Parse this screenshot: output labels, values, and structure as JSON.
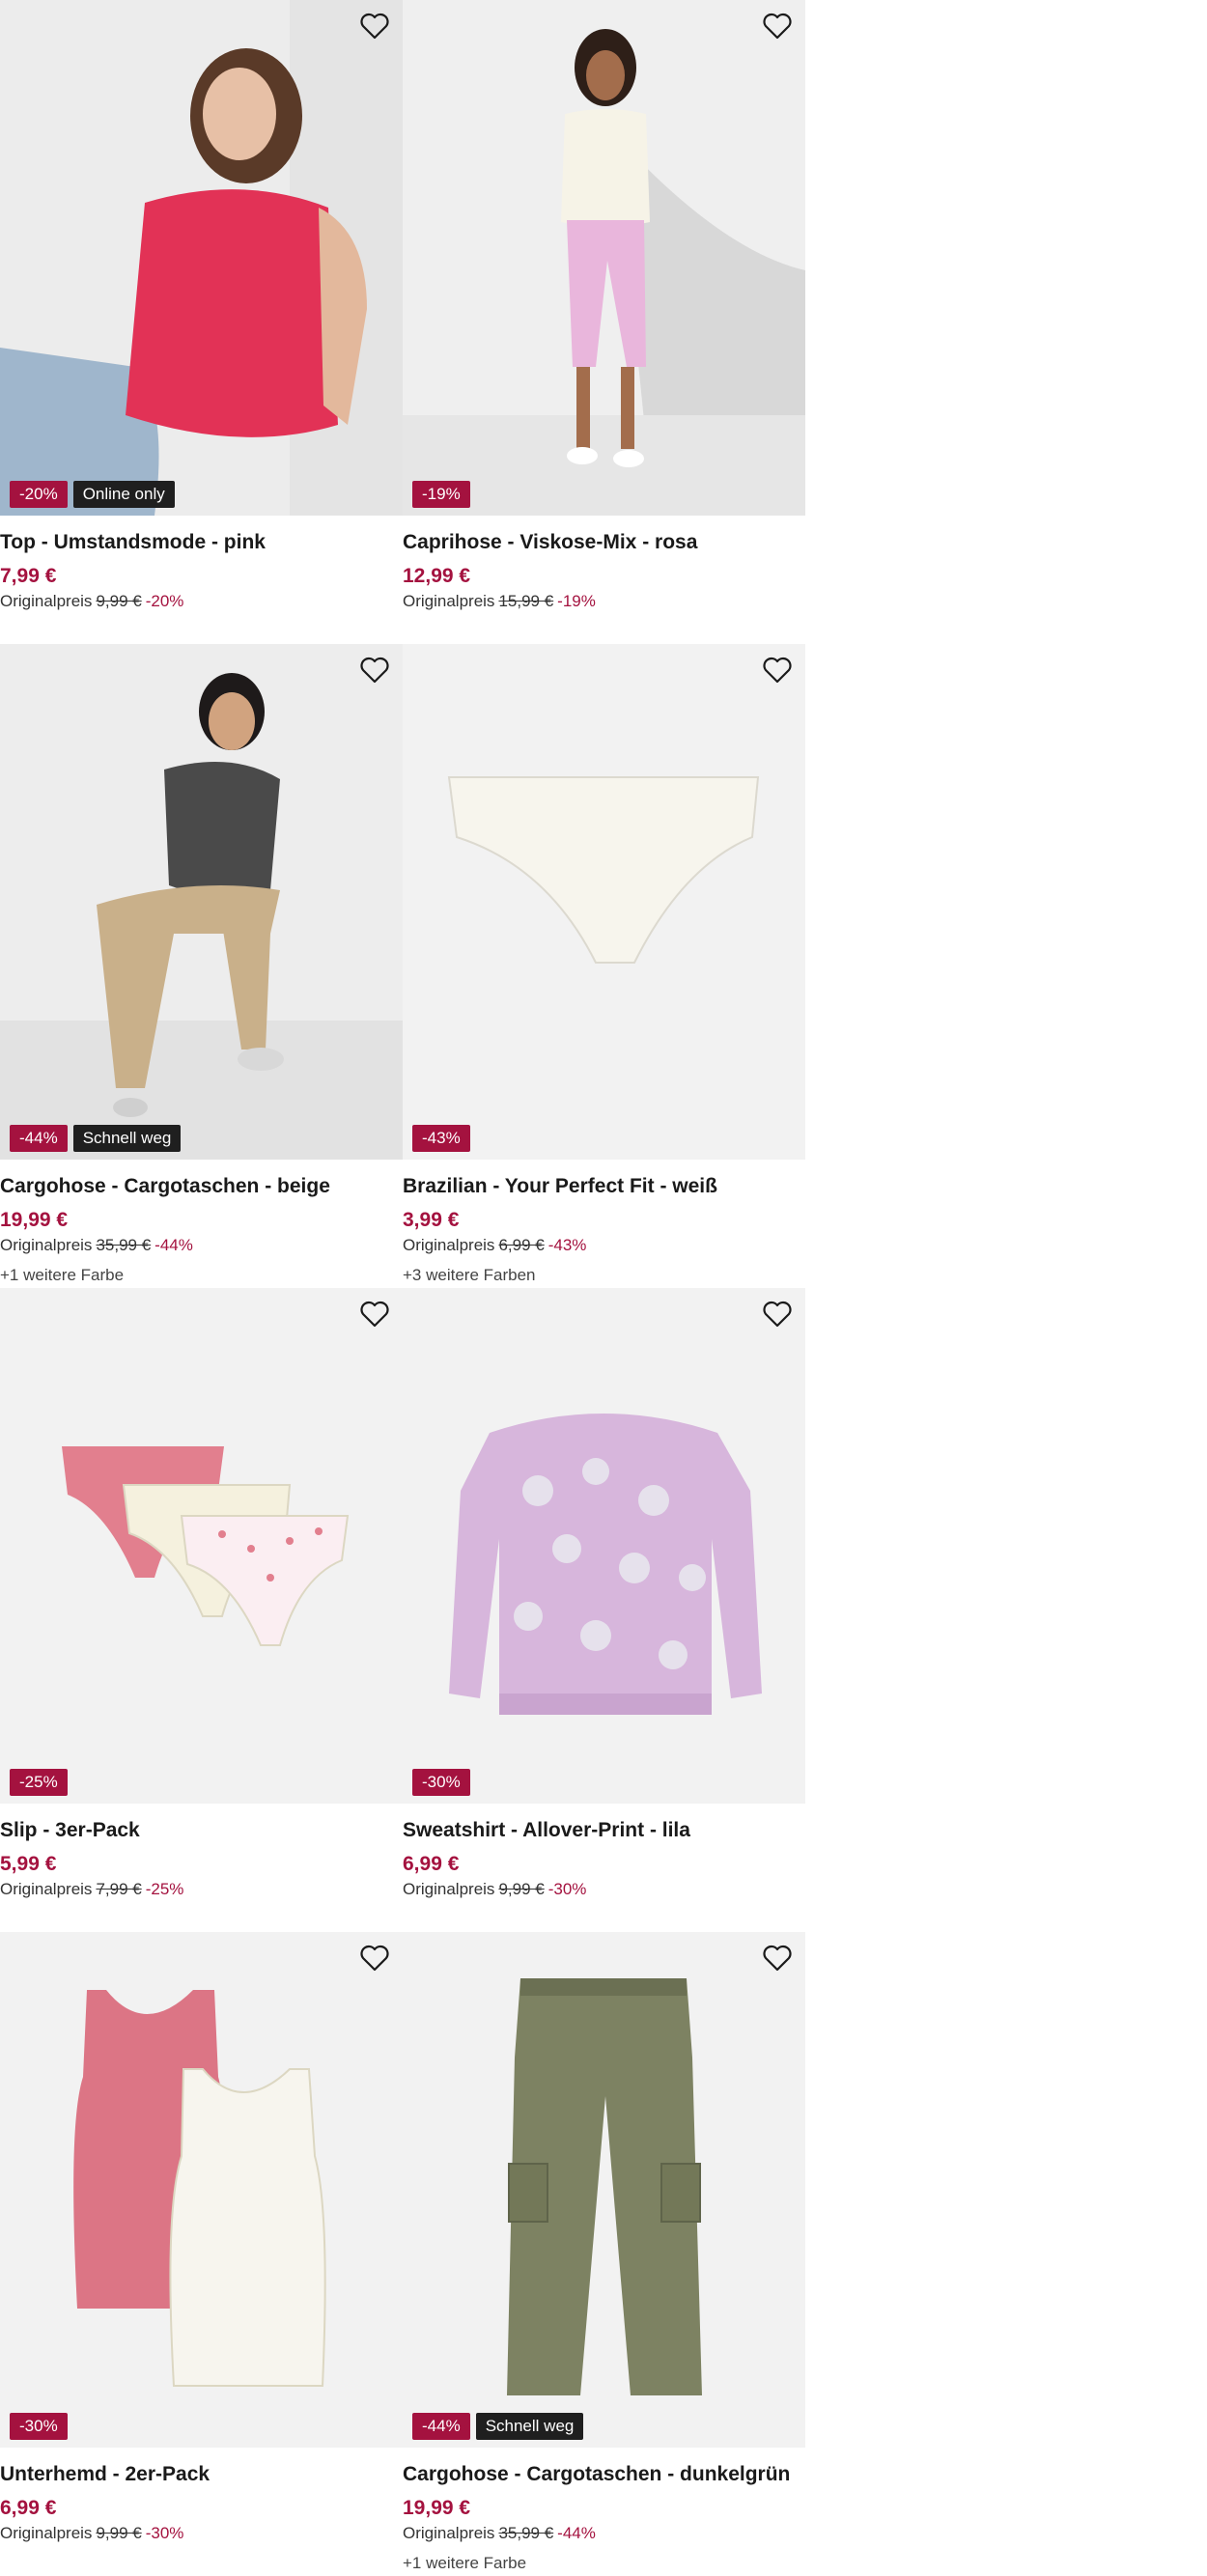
{
  "products": [
    {
      "name": "Top - Umstandsmode - pink",
      "price": "7,99 €",
      "orig_label": "Originalpreis",
      "orig_price": "9,99 €",
      "orig_pct": "-20%",
      "badges": [
        "-20%",
        "Online only"
      ],
      "colors": ""
    },
    {
      "name": "Caprihose - Viskose-Mix - rosa",
      "price": "12,99 €",
      "orig_label": "Originalpreis",
      "orig_price": "15,99 €",
      "orig_pct": "-19%",
      "badges": [
        "-19%"
      ],
      "colors": ""
    },
    {
      "name": "Cargohose - Cargotaschen - beige",
      "price": "19,99 €",
      "orig_label": "Originalpreis",
      "orig_price": "35,99 €",
      "orig_pct": "-44%",
      "badges": [
        "-44%",
        "Schnell weg"
      ],
      "colors": "+1 weitere Farbe"
    },
    {
      "name": "Brazilian - Your Perfect Fit - weiß",
      "price": "3,99 €",
      "orig_label": "Originalpreis",
      "orig_price": "6,99 €",
      "orig_pct": "-43%",
      "badges": [
        "-43%"
      ],
      "colors": "+3 weitere Farben"
    },
    {
      "name": "Slip - 3er-Pack",
      "price": "5,99 €",
      "orig_label": "Originalpreis",
      "orig_price": "7,99 €",
      "orig_pct": "-25%",
      "badges": [
        "-25%"
      ],
      "colors": ""
    },
    {
      "name": "Sweatshirt - Allover-Print - lila",
      "price": "6,99 €",
      "orig_label": "Originalpreis",
      "orig_price": "9,99 €",
      "orig_pct": "-30%",
      "badges": [
        "-30%"
      ],
      "colors": ""
    },
    {
      "name": "Unterhemd - 2er-Pack",
      "price": "6,99 €",
      "orig_label": "Originalpreis",
      "orig_price": "9,99 €",
      "orig_pct": "-30%",
      "badges": [
        "-30%"
      ],
      "colors": ""
    },
    {
      "name": "Cargohose - Cargotaschen - dunkelgrün",
      "price": "19,99 €",
      "orig_label": "Originalpreis",
      "orig_price": "35,99 €",
      "orig_pct": "-44%",
      "badges": [
        "-44%",
        "Schnell weg"
      ],
      "colors": "+1 weitere Farbe"
    }
  ],
  "icons": {
    "wishlist": "heart-outline-icon"
  },
  "colors": {
    "discount": "#a4123f",
    "info_badge": "#1f1f1f",
    "image_bg": "#f2f2f2"
  }
}
